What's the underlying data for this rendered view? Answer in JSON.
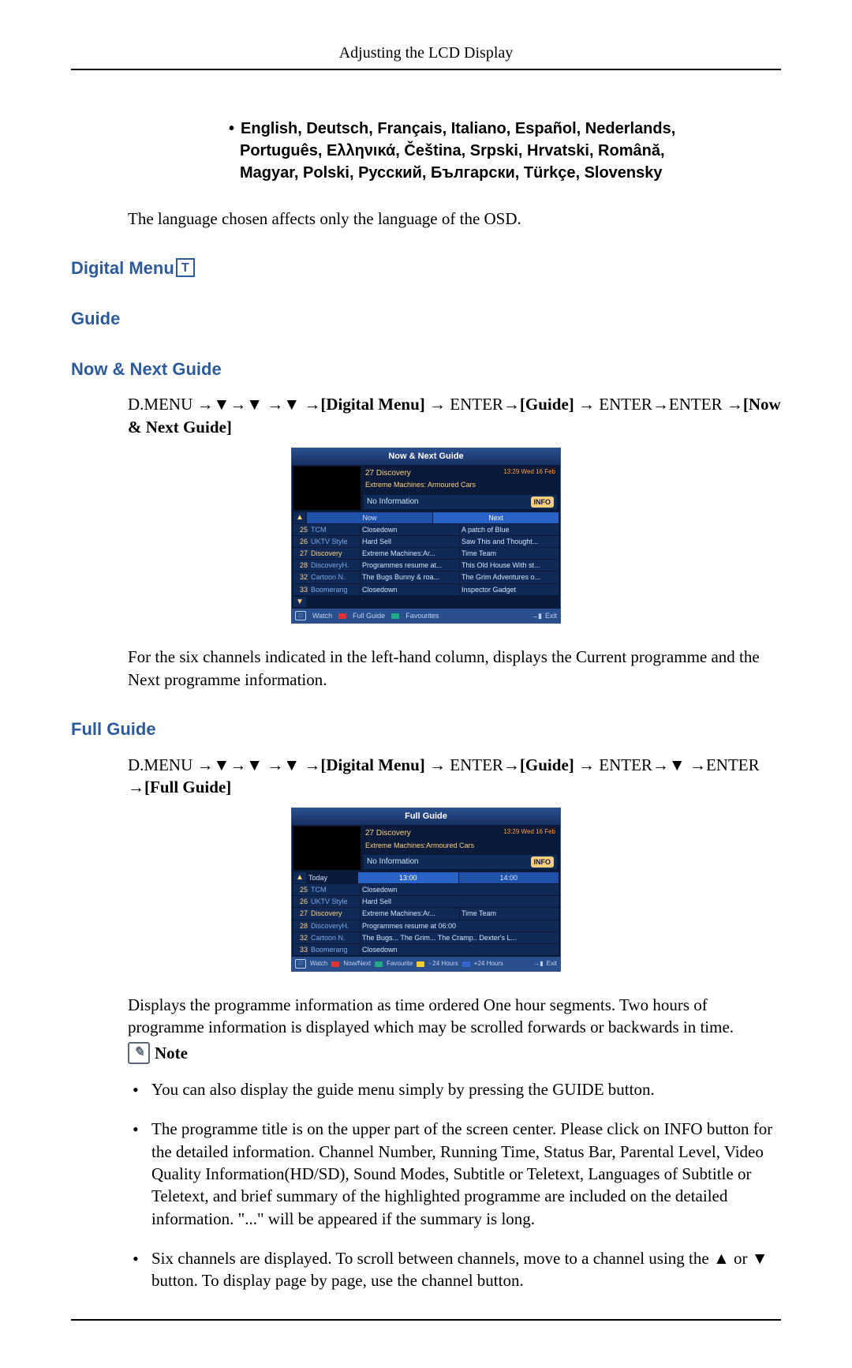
{
  "header": "Adjusting the LCD Display",
  "languages_line1": "English, Deutsch, Français, Italiano, Español, Nederlands,",
  "languages_line2": "Português, Ελληνικά, Čeština, Srpski, Hrvatski, Română,",
  "languages_line3": "Magyar, Polski, Русский, Български, Türkçe, Slovensky",
  "lang_note": "The language chosen affects only the language of the OSD.",
  "sections": {
    "digital_menu": "Digital Menu",
    "guide": "Guide",
    "now_next": "Now & Next Guide",
    "full": "Full Guide"
  },
  "badge_letter": "T",
  "now_next_path": {
    "pre": "D.MENU →▼→▼ →▼ →",
    "a": "[Digital Menu]",
    "mid1": " → ENTER→",
    "b": "[Guide]",
    "mid2": " → ENTER→ENTER →",
    "c": "[Now & Next Guide]"
  },
  "now_next_desc": "For the six channels indicated in the left-hand column, displays the Current programme and the Next programme information.",
  "full_path": {
    "pre": "D.MENU →▼→▼ →▼ →",
    "a": "[Digital Menu]",
    "mid1": " → ENTER→",
    "b": "[Guide]",
    "mid2": " → ENTER→▼ →ENTER →",
    "c": "[Full Guide]"
  },
  "full_desc": "Displays the programme information as time ordered One hour segments. Two hours of programme information is displayed which may be scrolled forwards or backwards in time.",
  "note_label": "Note",
  "notes": [
    "You can also display the guide menu simply by pressing the GUIDE button.",
    "The programme title is on the upper part of the screen center. Please click on INFO button for the detailed information. Channel Number, Running Time, Status Bar, Parental Level, Video Quality Information(HD/SD), Sound Modes, Subtitle or Teletext, Languages of Subtitle or Teletext, and brief summary of the highlighted programme are included on the detailed information. \"...\" will be appeared if the summary is long.",
    "Six channels are displayed. To scroll between channels, move to a channel using the ▲ or ▼ button. To display page by page, use the channel button."
  ],
  "now_next_guide": {
    "title": "Now & Next Guide",
    "channel": "27 Discovery",
    "datetime": "13:29 Wed 16 Feb",
    "prog": "Extreme Machines: Armoured Cars",
    "noinfo": "No Information",
    "info_btn": "INFO",
    "col_now": "Now",
    "col_next": "Next",
    "rows": [
      {
        "n": "25",
        "ch": "TCM",
        "now": "Closedown",
        "next": "A patch of Blue"
      },
      {
        "n": "26",
        "ch": "UKTV Style",
        "now": "Hard Sell",
        "next": "Saw This and Thought..."
      },
      {
        "n": "27",
        "ch": "Discovery",
        "now": "Extreme Machines:Ar...",
        "next": "Time Team"
      },
      {
        "n": "28",
        "ch": "DiscoveryH.",
        "now": "Programmes resume at...",
        "next": "This Old House With st..."
      },
      {
        "n": "32",
        "ch": "Cartoon N.",
        "now": "The Bugs Bunny & roa...",
        "next": "The Grim Adventures o..."
      },
      {
        "n": "33",
        "ch": "Boomerang",
        "now": "Closedown",
        "next": "Inspector Gadget"
      }
    ],
    "legend": {
      "watch": "Watch",
      "full": "Full Guide",
      "fav": "Favourites",
      "exit": "Exit"
    }
  },
  "full_guide": {
    "title": "Full Guide",
    "channel": "27 Discovery",
    "datetime": "13:29 Wed 16 Feb",
    "prog": "Extreme Machines:Armoured Cars",
    "noinfo": "No Information",
    "info_btn": "INFO",
    "today": "Today",
    "t1": "13:00",
    "t2": "14:00",
    "rows": [
      {
        "n": "25",
        "ch": "TCM",
        "c1": "Closedown",
        "c2": ""
      },
      {
        "n": "26",
        "ch": "UKTV Style",
        "c1": "Hard Sell",
        "c2": ""
      },
      {
        "n": "27",
        "ch": "Discovery",
        "c1": "Extreme Machines:Ar...",
        "c2": "Time Team"
      },
      {
        "n": "28",
        "ch": "DiscoveryH.",
        "c1": "Programmes resume at 06:00",
        "c2": ""
      },
      {
        "n": "32",
        "ch": "Cartoon N.",
        "c1": "The Bugs... The Grim...   The Cramp.. Dexter's L...",
        "c2": ""
      },
      {
        "n": "33",
        "ch": "Boomerang",
        "c1": "Closedown",
        "c2": ""
      }
    ],
    "legend": {
      "watch": "Watch",
      "nownext": "Now/Next",
      "fav": "Favourite",
      "m24": "- 24 Hours",
      "p24": "+24 Hours",
      "exit": "Exit"
    }
  }
}
